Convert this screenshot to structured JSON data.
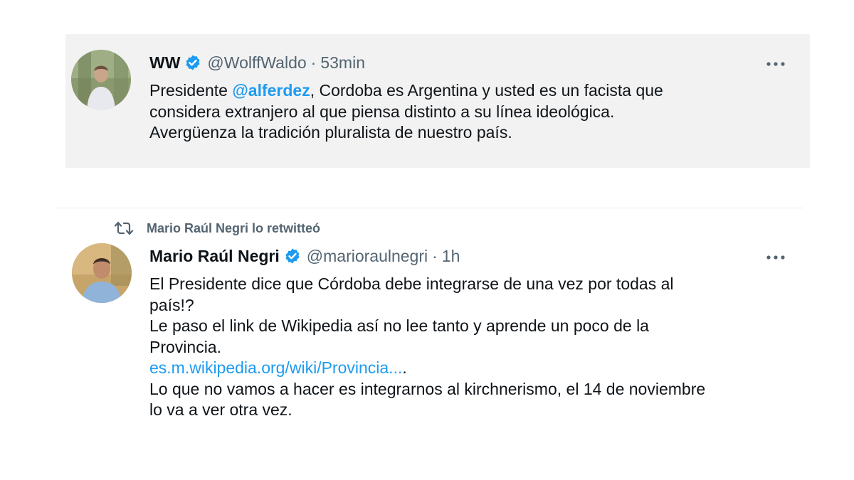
{
  "tweet1": {
    "display_name": "WW",
    "handle": "@WolffWaldo",
    "separator": "·",
    "time": "53min",
    "text_before": "Presidente ",
    "mention": "@alferdez",
    "text_after": ", Cordoba es Argentina y usted es un facista que",
    "lines": [
      "considera extranjero al que piensa distinto a su línea ideológica.",
      "Avergüenza la tradición pluralista de nuestro país."
    ]
  },
  "tweet2": {
    "retweet_label": "Mario Raúl Negri lo retwitteó",
    "display_name": "Mario Raúl Negri",
    "handle": "@marioraulnegri",
    "separator": "·",
    "time": "1h",
    "lines": [
      "El Presidente dice que Córdoba debe integrarse de una vez por todas al",
      "país!?",
      "Le paso el link de Wikipedia así no lee tanto y aprende un poco de la",
      "Provincia."
    ],
    "link": "es.m.wikipedia.org/wiki/Provincia...",
    "link_suffix": ".",
    "lines_after": [
      "Lo que no vamos a hacer es integrarnos al kirchnerismo, el 14 de noviembre",
      "lo va a ver otra vez."
    ]
  },
  "colors": {
    "link": "#1d9bf0",
    "secondary_text": "#536471",
    "card_background": "#f2f2f2",
    "verified_badge": "#1d9bf0"
  },
  "icons": {
    "verified": "verified-badge-icon",
    "more": "more-dots-icon",
    "retweet": "retweet-icon"
  }
}
